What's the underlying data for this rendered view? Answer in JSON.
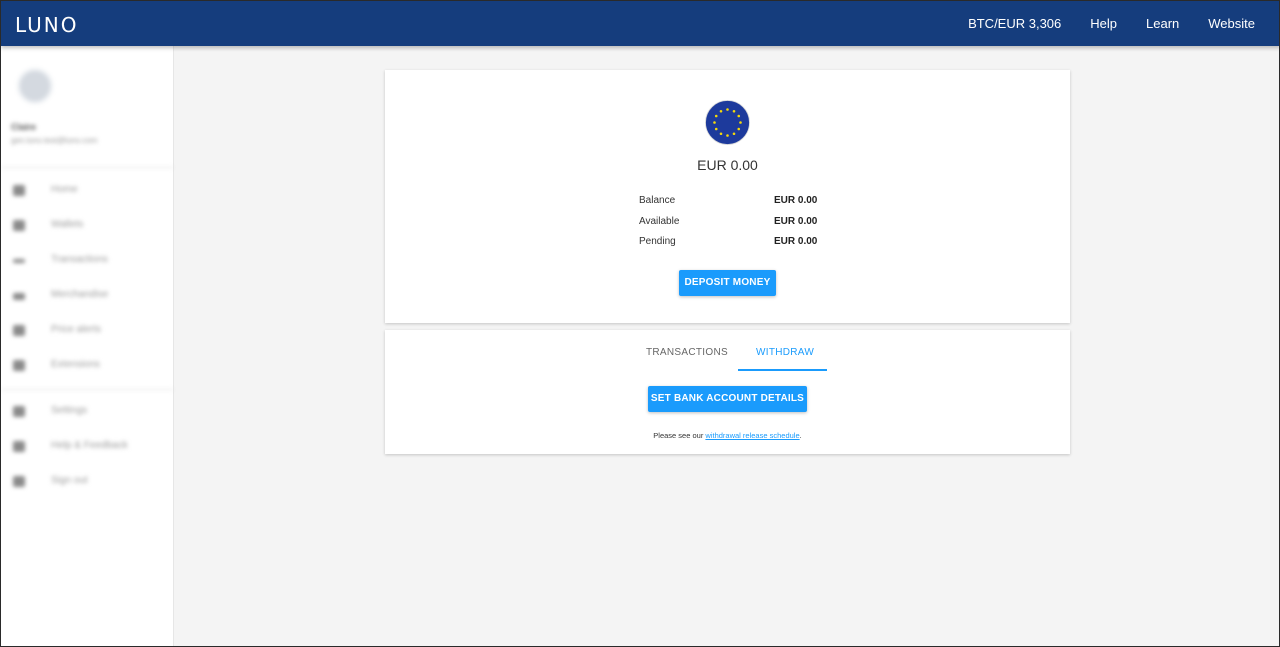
{
  "header": {
    "logo": "LUNO",
    "price_ticker": "BTC/EUR 3,306",
    "nav": [
      "Help",
      "Learn",
      "Website"
    ]
  },
  "sidebar": {
    "profile": {
      "name": "Claire",
      "email": "gen.luno.test@luno.com"
    },
    "items_primary": [
      {
        "label": "Home",
        "icon": "home-icon"
      },
      {
        "label": "Wallets",
        "icon": "wallet-icon"
      },
      {
        "label": "Transactions",
        "icon": "transactions-icon"
      },
      {
        "label": "Merchandise",
        "icon": "merchandise-icon"
      },
      {
        "label": "Price alerts",
        "icon": "bell-icon"
      },
      {
        "label": "Extensions",
        "icon": "extension-icon"
      }
    ],
    "items_secondary": [
      {
        "label": "Settings",
        "icon": "gear-icon"
      },
      {
        "label": "Help & Feedback",
        "icon": "help-icon"
      },
      {
        "label": "Sign out",
        "icon": "signout-icon"
      }
    ]
  },
  "wallet": {
    "currency_flag": "eu-flag-icon",
    "title": "EUR 0.00",
    "rows": [
      {
        "label": "Balance",
        "value": "EUR 0.00"
      },
      {
        "label": "Available",
        "value": "EUR 0.00"
      },
      {
        "label": "Pending",
        "value": "EUR 0.00"
      }
    ],
    "deposit_label": "DEPOSIT MONEY"
  },
  "tabs": {
    "transactions_label": "TRANSACTIONS",
    "withdraw_label": "WITHDRAW",
    "active": "WITHDRAW"
  },
  "withdraw": {
    "bank_button_label": "SET BANK ACCOUNT DETAILS",
    "note_prefix": "Please see our ",
    "note_link": "withdrawal release schedule",
    "note_suffix": "."
  },
  "colors": {
    "header_bg": "#153d7d",
    "accent": "#1a9bfc",
    "page_bg": "#f4f4f4",
    "flag_blue": "#1d3a9c",
    "flag_star": "#f5d90a"
  }
}
